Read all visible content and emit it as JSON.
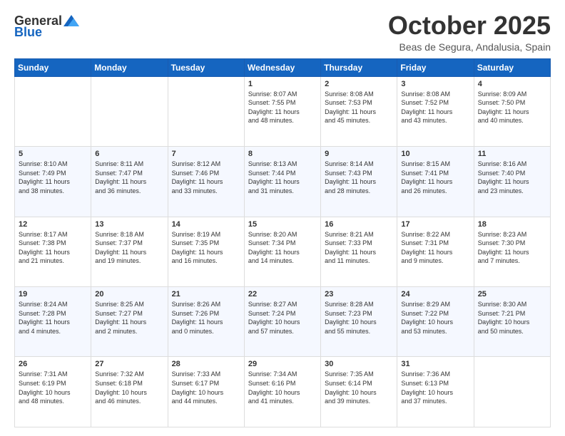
{
  "logo": {
    "general": "General",
    "blue": "Blue"
  },
  "header": {
    "month": "October 2025",
    "location": "Beas de Segura, Andalusia, Spain"
  },
  "weekdays": [
    "Sunday",
    "Monday",
    "Tuesday",
    "Wednesday",
    "Thursday",
    "Friday",
    "Saturday"
  ],
  "weeks": [
    [
      {
        "day": "",
        "info": ""
      },
      {
        "day": "",
        "info": ""
      },
      {
        "day": "",
        "info": ""
      },
      {
        "day": "1",
        "info": "Sunrise: 8:07 AM\nSunset: 7:55 PM\nDaylight: 11 hours\nand 48 minutes."
      },
      {
        "day": "2",
        "info": "Sunrise: 8:08 AM\nSunset: 7:53 PM\nDaylight: 11 hours\nand 45 minutes."
      },
      {
        "day": "3",
        "info": "Sunrise: 8:08 AM\nSunset: 7:52 PM\nDaylight: 11 hours\nand 43 minutes."
      },
      {
        "day": "4",
        "info": "Sunrise: 8:09 AM\nSunset: 7:50 PM\nDaylight: 11 hours\nand 40 minutes."
      }
    ],
    [
      {
        "day": "5",
        "info": "Sunrise: 8:10 AM\nSunset: 7:49 PM\nDaylight: 11 hours\nand 38 minutes."
      },
      {
        "day": "6",
        "info": "Sunrise: 8:11 AM\nSunset: 7:47 PM\nDaylight: 11 hours\nand 36 minutes."
      },
      {
        "day": "7",
        "info": "Sunrise: 8:12 AM\nSunset: 7:46 PM\nDaylight: 11 hours\nand 33 minutes."
      },
      {
        "day": "8",
        "info": "Sunrise: 8:13 AM\nSunset: 7:44 PM\nDaylight: 11 hours\nand 31 minutes."
      },
      {
        "day": "9",
        "info": "Sunrise: 8:14 AM\nSunset: 7:43 PM\nDaylight: 11 hours\nand 28 minutes."
      },
      {
        "day": "10",
        "info": "Sunrise: 8:15 AM\nSunset: 7:41 PM\nDaylight: 11 hours\nand 26 minutes."
      },
      {
        "day": "11",
        "info": "Sunrise: 8:16 AM\nSunset: 7:40 PM\nDaylight: 11 hours\nand 23 minutes."
      }
    ],
    [
      {
        "day": "12",
        "info": "Sunrise: 8:17 AM\nSunset: 7:38 PM\nDaylight: 11 hours\nand 21 minutes."
      },
      {
        "day": "13",
        "info": "Sunrise: 8:18 AM\nSunset: 7:37 PM\nDaylight: 11 hours\nand 19 minutes."
      },
      {
        "day": "14",
        "info": "Sunrise: 8:19 AM\nSunset: 7:35 PM\nDaylight: 11 hours\nand 16 minutes."
      },
      {
        "day": "15",
        "info": "Sunrise: 8:20 AM\nSunset: 7:34 PM\nDaylight: 11 hours\nand 14 minutes."
      },
      {
        "day": "16",
        "info": "Sunrise: 8:21 AM\nSunset: 7:33 PM\nDaylight: 11 hours\nand 11 minutes."
      },
      {
        "day": "17",
        "info": "Sunrise: 8:22 AM\nSunset: 7:31 PM\nDaylight: 11 hours\nand 9 minutes."
      },
      {
        "day": "18",
        "info": "Sunrise: 8:23 AM\nSunset: 7:30 PM\nDaylight: 11 hours\nand 7 minutes."
      }
    ],
    [
      {
        "day": "19",
        "info": "Sunrise: 8:24 AM\nSunset: 7:28 PM\nDaylight: 11 hours\nand 4 minutes."
      },
      {
        "day": "20",
        "info": "Sunrise: 8:25 AM\nSunset: 7:27 PM\nDaylight: 11 hours\nand 2 minutes."
      },
      {
        "day": "21",
        "info": "Sunrise: 8:26 AM\nSunset: 7:26 PM\nDaylight: 11 hours\nand 0 minutes."
      },
      {
        "day": "22",
        "info": "Sunrise: 8:27 AM\nSunset: 7:24 PM\nDaylight: 10 hours\nand 57 minutes."
      },
      {
        "day": "23",
        "info": "Sunrise: 8:28 AM\nSunset: 7:23 PM\nDaylight: 10 hours\nand 55 minutes."
      },
      {
        "day": "24",
        "info": "Sunrise: 8:29 AM\nSunset: 7:22 PM\nDaylight: 10 hours\nand 53 minutes."
      },
      {
        "day": "25",
        "info": "Sunrise: 8:30 AM\nSunset: 7:21 PM\nDaylight: 10 hours\nand 50 minutes."
      }
    ],
    [
      {
        "day": "26",
        "info": "Sunrise: 7:31 AM\nSunset: 6:19 PM\nDaylight: 10 hours\nand 48 minutes."
      },
      {
        "day": "27",
        "info": "Sunrise: 7:32 AM\nSunset: 6:18 PM\nDaylight: 10 hours\nand 46 minutes."
      },
      {
        "day": "28",
        "info": "Sunrise: 7:33 AM\nSunset: 6:17 PM\nDaylight: 10 hours\nand 44 minutes."
      },
      {
        "day": "29",
        "info": "Sunrise: 7:34 AM\nSunset: 6:16 PM\nDaylight: 10 hours\nand 41 minutes."
      },
      {
        "day": "30",
        "info": "Sunrise: 7:35 AM\nSunset: 6:14 PM\nDaylight: 10 hours\nand 39 minutes."
      },
      {
        "day": "31",
        "info": "Sunrise: 7:36 AM\nSunset: 6:13 PM\nDaylight: 10 hours\nand 37 minutes."
      },
      {
        "day": "",
        "info": ""
      }
    ]
  ]
}
